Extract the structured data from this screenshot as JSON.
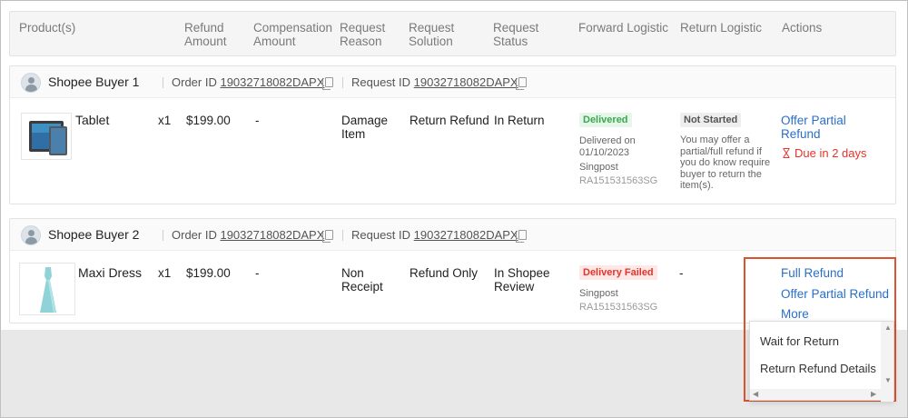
{
  "header": {
    "columns": {
      "products": "Product(s)",
      "refund_amount": "Refund\nAmount",
      "compensation_amount": "Compensation\nAmount",
      "request_reason": "Request\nReason",
      "request_solution": "Request\nSolution",
      "request_status": "Request\nStatus",
      "forward_logistic": "Forward Logistic",
      "return_logistic": "Return Logistic",
      "actions": "Actions"
    }
  },
  "orders": [
    {
      "buyer": "Shopee Buyer 1",
      "order_label": "Order ID",
      "order_id": "19032718082DAPX",
      "request_label": "Request ID",
      "request_id": "19032718082DAPX",
      "product_name": "Tablet",
      "qty": "x1",
      "refund": "$199.00",
      "compensation": "-",
      "reason": "Damage\nItem",
      "solution": "Return Refund",
      "status": "In Return",
      "forward": {
        "tag": "Delivered",
        "line1": "Delivered on",
        "line2": "01/10/2023",
        "carrier": "Singpost",
        "tracking": "RA151531563SG"
      },
      "return": {
        "tag": "Not Started",
        "note": "You may offer a\npartial/full refund if\nyou do know require\nbuyer to return the\nitem(s)."
      },
      "actions": {
        "offer_partial": "Offer Partial\nRefund",
        "due": "Due in 2 days"
      }
    },
    {
      "buyer": "Shopee Buyer 2",
      "order_label": "Order ID",
      "order_id": "19032718082DAPX",
      "request_label": "Request ID",
      "request_id": "19032718082DAPX",
      "product_name": "Maxi Dress",
      "qty": "x1",
      "refund": "$199.00",
      "compensation": "-",
      "reason": "Non\nReceipt",
      "solution": "Refund Only",
      "status": "In Shopee\nReview",
      "forward": {
        "tag": "Delivery Failed",
        "carrier": "Singpost",
        "tracking": "RA151531563SG"
      },
      "return": {
        "dash": "-"
      },
      "actions": {
        "full_refund": "Full Refund",
        "offer_partial": "Offer Partial Refund",
        "more": "More"
      }
    }
  ],
  "more_menu": {
    "items": [
      "Wait for Return",
      "Return Refund Details"
    ]
  },
  "colors": {
    "link": "#2a6fc9",
    "due": "#e5332a",
    "highlight": "#e0522f",
    "delivered_bg": "#e6f6e9",
    "delivered_fg": "#3aa84f",
    "failed_bg": "#fde8e6",
    "failed_fg": "#e5332a",
    "not_started_bg": "#eeeeee"
  },
  "icons": [
    "user-avatar-icon",
    "copy-icon",
    "hourglass-icon",
    "tablet-image",
    "maxi-dress-image"
  ]
}
